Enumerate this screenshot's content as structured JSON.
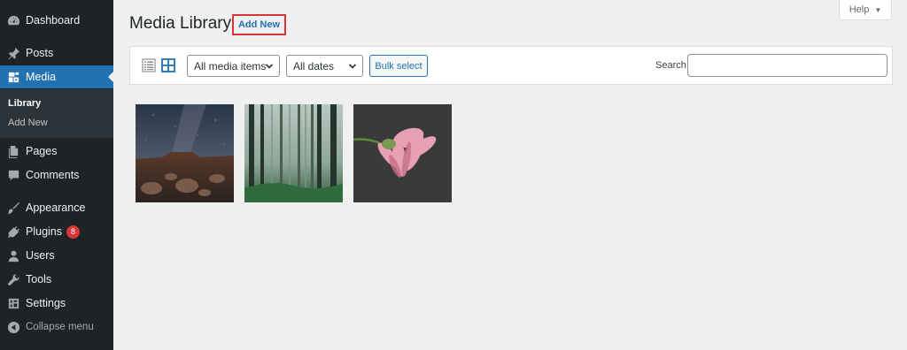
{
  "sidebar": {
    "items": [
      {
        "label": "Dashboard",
        "icon": "dashboard-icon"
      },
      {
        "label": "Posts",
        "icon": "pin-icon"
      },
      {
        "label": "Media",
        "icon": "media-icon"
      },
      {
        "label": "Pages",
        "icon": "pages-icon"
      },
      {
        "label": "Comments",
        "icon": "comment-icon"
      },
      {
        "label": "Appearance",
        "icon": "brush-icon"
      },
      {
        "label": "Plugins",
        "icon": "plug-icon"
      },
      {
        "label": "Users",
        "icon": "user-icon"
      },
      {
        "label": "Tools",
        "icon": "wrench-icon"
      },
      {
        "label": "Settings",
        "icon": "settings-icon"
      }
    ],
    "submenu": [
      "Library",
      "Add New"
    ],
    "plugins_badge": "8",
    "collapse_label": "Collapse menu",
    "active_color": "#2271b1"
  },
  "help": {
    "label": "Help",
    "caret": "▼"
  },
  "header": {
    "title": "Media Library",
    "add_new_label": "Add New",
    "highlight_color": "#d63638"
  },
  "toolbar": {
    "media_filter": "All media items",
    "date_filter": "All dates",
    "bulk_label": "Bulk select",
    "search_label": "Search",
    "search_value": ""
  },
  "media": [
    "night-sky-rocks-photo",
    "misty-forest-photo",
    "pink-flower-photo"
  ]
}
